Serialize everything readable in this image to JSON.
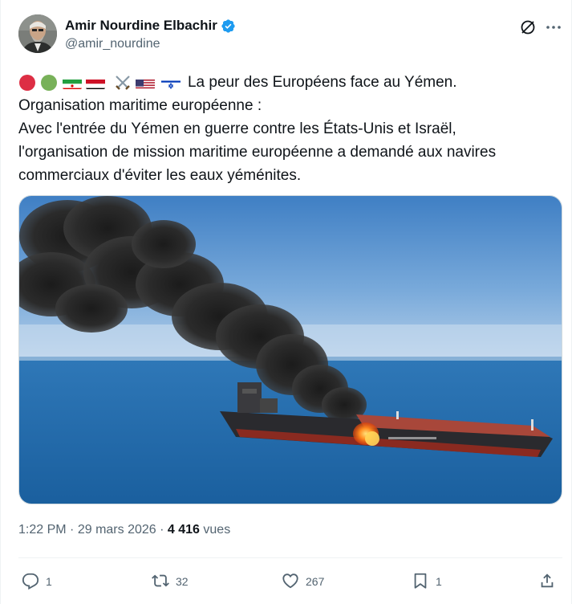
{
  "author": {
    "display_name": "Amir Nourdine Elbachir",
    "handle": "@amir_nourdine",
    "verified": true
  },
  "tweet": {
    "emoji_prefix": [
      "red-circle",
      "green-circle",
      "iran-flag",
      "yemen-flag",
      "crossed-swords",
      "us-flag",
      "israel-flag"
    ],
    "line1": "La peur des Européens face au Yémen.",
    "line2": "Organisation maritime européenne :",
    "line3": "Avec l'entrée du Yémen en guerre contre les États-Unis et Israël,",
    "line4": "l'organisation de mission maritime européenne a demandé aux navires",
    "line5": "commerciaux d'éviter les eaux yéménites."
  },
  "meta": {
    "time": "1:22 PM",
    "separator": "·",
    "date": "29 mars 2026",
    "views_count": "4 416",
    "views_label": "vues"
  },
  "actions": {
    "replies": "1",
    "reposts": "32",
    "likes": "267",
    "bookmarks": "1"
  },
  "colors": {
    "verified_blue": "#1d9bf0",
    "text_primary": "#0f1419",
    "text_secondary": "#536471"
  }
}
